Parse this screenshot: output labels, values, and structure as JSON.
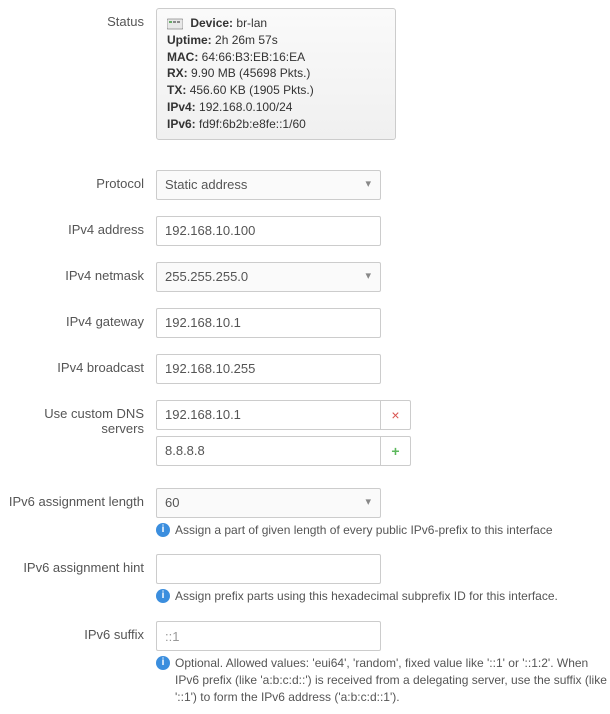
{
  "labels": {
    "status": "Status",
    "protocol": "Protocol",
    "ipv4_address": "IPv4 address",
    "ipv4_netmask": "IPv4 netmask",
    "ipv4_gateway": "IPv4 gateway",
    "ipv4_broadcast": "IPv4 broadcast",
    "custom_dns": "Use custom DNS servers",
    "ipv6_assign_len": "IPv6 assignment length",
    "ipv6_assign_hint": "IPv6 assignment hint",
    "ipv6_suffix": "IPv6 suffix"
  },
  "status": {
    "device_label": "Device:",
    "device": "br-lan",
    "uptime_label": "Uptime:",
    "uptime": "2h 26m 57s",
    "mac_label": "MAC:",
    "mac": "64:66:B3:EB:16:EA",
    "rx_label": "RX:",
    "rx": "9.90 MB (45698 Pkts.)",
    "tx_label": "TX:",
    "tx": "456.60 KB (1905 Pkts.)",
    "ipv4_label": "IPv4:",
    "ipv4": "192.168.0.100/24",
    "ipv6_label": "IPv6:",
    "ipv6": "fd9f:6b2b:e8fe::1/60"
  },
  "protocol": {
    "value": "Static address"
  },
  "ipv4_address": {
    "value": "192.168.10.100"
  },
  "ipv4_netmask": {
    "value": "255.255.255.0"
  },
  "ipv4_gateway": {
    "value": "192.168.10.1"
  },
  "ipv4_broadcast": {
    "value": "192.168.10.255"
  },
  "dns": {
    "entry1": "192.168.10.1",
    "entry2": "8.8.8.8"
  },
  "ipv6_assign_len": {
    "value": "60",
    "hint": "Assign a part of given length of every public IPv6-prefix to this interface"
  },
  "ipv6_assign_hint": {
    "hint": "Assign prefix parts using this hexadecimal subprefix ID for this interface."
  },
  "ipv6_suffix": {
    "placeholder": "::1",
    "hint": "Optional. Allowed values: 'eui64', 'random', fixed value like '::1' or '::1:2'. When IPv6 prefix (like 'a:b:c:d::') is received from a delegating server, use the suffix (like '::1') to form the IPv6 address ('a:b:c:d::1')."
  },
  "icons": {
    "info": "i"
  }
}
